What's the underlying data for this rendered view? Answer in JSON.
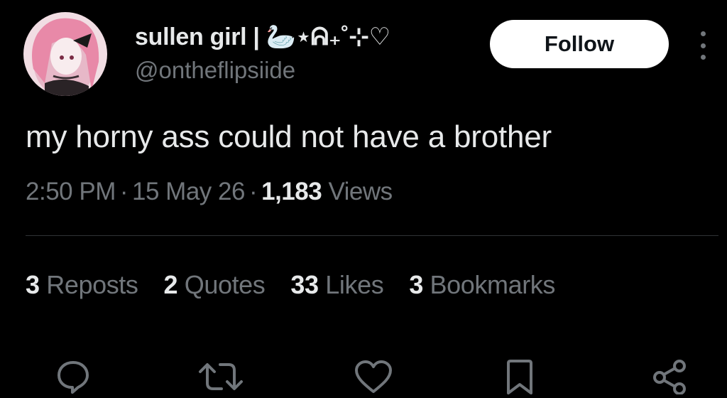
{
  "author": {
    "display_name": "sullen girl | 🦢⋆ᕱ₊˚⊹♡",
    "handle": "@ontheflipsiide"
  },
  "follow_label": "Follow",
  "tweet": {
    "text": "my horny ass could not have a brother",
    "time": "2:50 PM",
    "date": "15 May 26",
    "views_count": "1,183",
    "views_label": "Views",
    "separator": "·"
  },
  "stats": {
    "reposts": {
      "count": "3",
      "label": "Reposts"
    },
    "quotes": {
      "count": "2",
      "label": "Quotes"
    },
    "likes": {
      "count": "33",
      "label": "Likes"
    },
    "bookmarks": {
      "count": "3",
      "label": "Bookmarks"
    }
  },
  "actions": [
    "reply-icon",
    "repost-icon",
    "like-icon",
    "bookmark-icon",
    "share-icon"
  ],
  "colors": {
    "background": "#000000",
    "primary_text": "#e7e9ea",
    "secondary_text": "#71767b",
    "divider": "#2f3336",
    "follow_bg": "#ffffff"
  }
}
